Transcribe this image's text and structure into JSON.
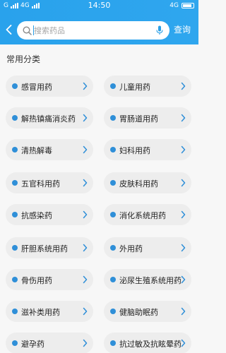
{
  "status_bar": {
    "left_signal_1": "G",
    "left_signal_2": "4G",
    "time": "14:50",
    "right_signal": "4G"
  },
  "header": {
    "search_placeholder": "搜索药品",
    "query_label": "查询",
    "accent_color": "#29a2ec"
  },
  "section": {
    "title": "常用分类"
  },
  "categories": [
    {
      "label": "感冒用药"
    },
    {
      "label": "儿童用药"
    },
    {
      "label": "解热镇痛消炎药"
    },
    {
      "label": "胃肠道用药"
    },
    {
      "label": "清热解毒"
    },
    {
      "label": "妇科用药"
    },
    {
      "label": "五官科用药"
    },
    {
      "label": "皮肤科用药"
    },
    {
      "label": "抗感染药"
    },
    {
      "label": "消化系统用药"
    },
    {
      "label": "肝胆系统用药"
    },
    {
      "label": "外用药"
    },
    {
      "label": "骨伤用药"
    },
    {
      "label": "泌尿生殖系统用药"
    },
    {
      "label": "滋补类用药"
    },
    {
      "label": "健脑助眠药"
    },
    {
      "label": "避孕药"
    },
    {
      "label": "抗过敏及抗眩晕药"
    }
  ]
}
